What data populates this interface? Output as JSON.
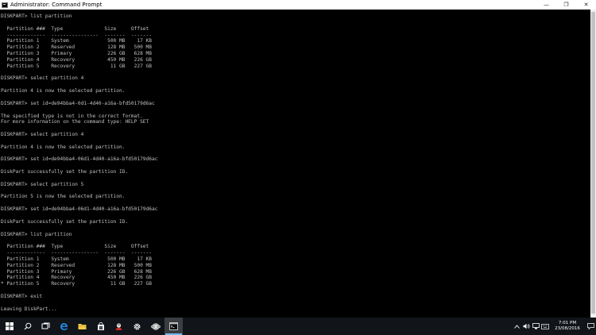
{
  "window": {
    "title": "Administrator: Command Prompt",
    "minimize_glyph": "—",
    "restore_glyph": "❐",
    "close_glyph": "✕"
  },
  "console": {
    "output": "DISKPART> list partition\n\n  Partition ###  Type              Size     Offset\n  -------------  ----------------  -------  -------\n  Partition 1    System             500 MB    17 KB\n  Partition 2    Reserved           128 MB   500 MB\n  Partition 3    Primary            226 GB   628 MB\n  Partition 4    Recovery           450 MB   226 GB\n  Partition 5    Recovery            11 GB   227 GB\n\nDISKPART> select partition 4\n\nPartition 4 is now the selected partition.\n\nDISKPART> set id=de94bba4-0d1-4d40-a16a-bfd50179d6ac\n\nThe specified type is not in the correct format.\nFor more information on the command type: HELP SET\n\nDISKPART> select partition 4\n\nPartition 4 is now the selected partition.\n\nDISKPART> set id=de94bba4-06d1-4d40-a16a-bfd50179d6ac\n\nDiskPart successfully set the partition ID.\n\nDISKPART> select partition 5\n\nPartition 5 is now the selected partition.\n\nDISKPART> set id=de94bba4-06d1-4d40-a16a-bfd50179d6ac\n\nDiskPart successfully set the partition ID.\n\nDISKPART> list partition\n\n  Partition ###  Type              Size     Offset\n  -------------  ----------------  -------  -------\n  Partition 1    System             500 MB    17 KB\n  Partition 2    Reserved           128 MB   500 MB\n  Partition 3    Primary            226 GB   628 MB\n  Partition 4    Recovery           450 MB   226 GB\n* Partition 5    Recovery            11 GB   227 GB\n\nDISKPART> exit\n\nLeaving DiskPart..."
  },
  "taskbar": {
    "icons": [
      "windows-start-icon",
      "search-icon",
      "task-view-icon",
      "edge-browser-icon",
      "file-explorer-icon",
      "store-icon",
      "media-app-icon",
      "settings-gear-icon",
      "network-app-icon",
      "command-prompt-icon"
    ],
    "active_icon": "command-prompt-icon",
    "tray_icons": [
      "chevron-up-icon",
      "volume-icon",
      "network-icon",
      "keyboard-icon"
    ],
    "time": "7:01 PM",
    "date": "23/08/2016"
  },
  "colors": {
    "console_bg": "#000000",
    "console_text": "#c0c0c0",
    "taskbar_bg": "#111418",
    "active_indicator": "#76b9ed",
    "edge_blue": "#1e88e5",
    "explorer_yellow": "#f2c94c"
  }
}
